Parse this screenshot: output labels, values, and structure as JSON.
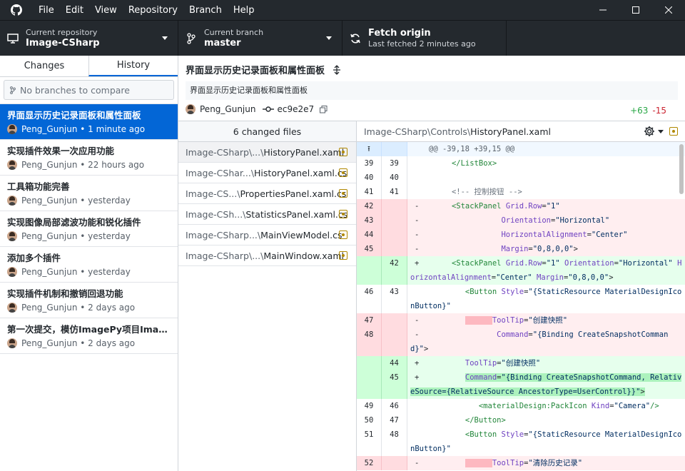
{
  "menu": [
    "File",
    "Edit",
    "View",
    "Repository",
    "Branch",
    "Help"
  ],
  "toolbar": {
    "repo_label": "Current repository",
    "repo_name": "Image-CSharp",
    "branch_label": "Current branch",
    "branch_name": "master",
    "fetch_title": "Fetch origin",
    "fetch_sub": "Last fetched 2 minutes ago"
  },
  "sidebar": {
    "tab_changes": "Changes",
    "tab_history": "History",
    "compare_placeholder": "No branches to compare",
    "commits": [
      {
        "title": "界面显示历史记录面板和属性面板",
        "meta": "Peng_Gunjun • 1 minute ago"
      },
      {
        "title": "实现插件效果一次应用功能",
        "meta": "Peng_Gunjun • 22 hours ago"
      },
      {
        "title": "工具箱功能完善",
        "meta": "Peng_Gunjun • yesterday"
      },
      {
        "title": "实现图像局部滤波功能和锐化插件",
        "meta": "Peng_Gunjun • yesterday"
      },
      {
        "title": "添加多个插件",
        "meta": "Peng_Gunjun • yesterday"
      },
      {
        "title": "实现插件机制和撤销回退功能",
        "meta": "Peng_Gunjun • 2 days ago"
      },
      {
        "title": "第一次提交，模仿ImagePy项目Image…",
        "meta": "Peng_Gunjun • 2 days ago"
      }
    ]
  },
  "commit": {
    "title": "界面显示历史记录面板和属性面板",
    "description": "界面显示历史记录面板和属性面板",
    "author": "Peng_Gunjun",
    "sha": "ec9e2e7",
    "additions": "+63",
    "deletions": "-15"
  },
  "files": {
    "header": "6 changed files",
    "items": [
      {
        "dir": "Image-CSharp\\...\\",
        "name": "HistoryPanel.xaml"
      },
      {
        "dir": "Image-CShar...\\",
        "name": "HistoryPanel.xaml.cs"
      },
      {
        "dir": "Image-CS...\\",
        "name": "PropertiesPanel.xaml.cs"
      },
      {
        "dir": "Image-CSh...\\",
        "name": "StatisticsPanel.xaml.cs"
      },
      {
        "dir": "Image-CSharp...\\",
        "name": "MainViewModel.cs"
      },
      {
        "dir": "Image-CSharp\\...\\",
        "name": "MainWindow.xaml"
      }
    ]
  },
  "diff": {
    "path_dir": "Image-CSharp\\Controls\\",
    "path_file": "HistoryPanel.xaml",
    "hunk": "@@ -39,18 +39,15 @@"
  },
  "colors": {
    "accent": "#0366d6",
    "additions": "#28a745",
    "deletions": "#cb2431",
    "modified": "#b08800"
  }
}
